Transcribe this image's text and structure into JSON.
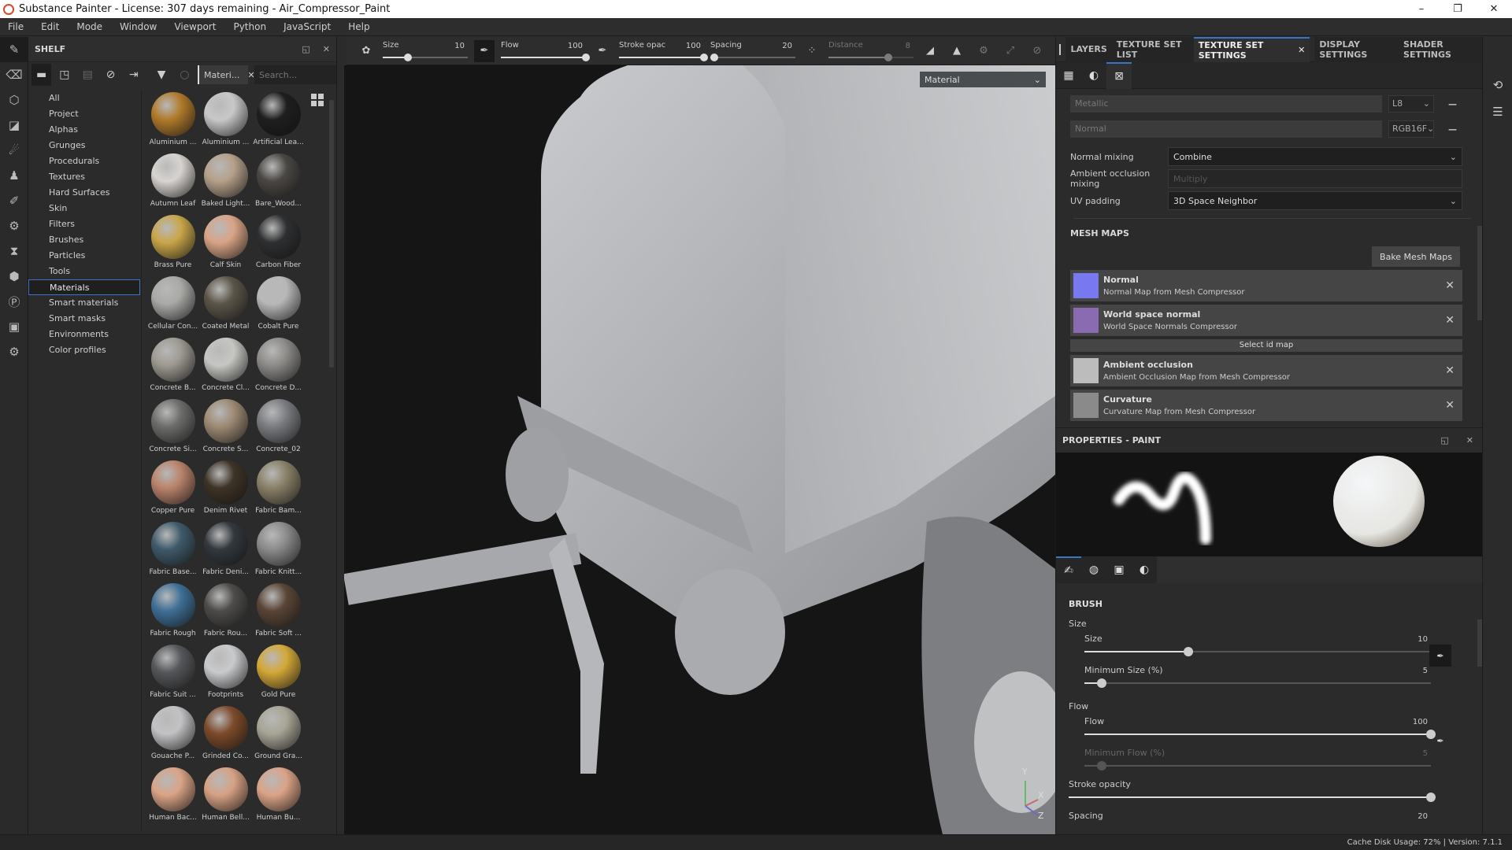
{
  "window": {
    "title": "Substance Painter - License: 307 days remaining - Air_Compressor_Paint",
    "minimize": "–",
    "restore": "❐",
    "close": "✕"
  },
  "menu": [
    "File",
    "Edit",
    "Mode",
    "Window",
    "Viewport",
    "Python",
    "JavaScript",
    "Help"
  ],
  "shelf": {
    "title": "SHELF",
    "filter_tab": "Materi...",
    "search_placeholder": "Search...",
    "categories": [
      "All",
      "Project",
      "Alphas",
      "Grunges",
      "Procedurals",
      "Textures",
      "Hard Surfaces",
      "Skin",
      "Filters",
      "Brushes",
      "Particles",
      "Tools",
      "Materials",
      "Smart materials",
      "Smart masks",
      "Environments",
      "Color profiles"
    ],
    "selected_category": "Materials",
    "materials": [
      {
        "name": "Aluminium ...",
        "color": "#b07a2a"
      },
      {
        "name": "Aluminium ...",
        "color": "#c8c8c8"
      },
      {
        "name": "Artificial Lea...",
        "color": "#1e1e1e"
      },
      {
        "name": "Autumn Leaf",
        "color": "#d8d4d0"
      },
      {
        "name": "Baked Light...",
        "color": "#b5a08a"
      },
      {
        "name": "Bare_Wood...",
        "color": "#4a4743"
      },
      {
        "name": "Brass Pure",
        "color": "#c9a64a"
      },
      {
        "name": "Calf Skin",
        "color": "#d9a487"
      },
      {
        "name": "Carbon Fiber",
        "color": "#2e2f31"
      },
      {
        "name": "Cellular Con...",
        "color": "#a9a9a6"
      },
      {
        "name": "Coated Metal",
        "color": "#5b5548"
      },
      {
        "name": "Cobalt Pure",
        "color": "#b8b8b8"
      },
      {
        "name": "Concrete B...",
        "color": "#9e9a92"
      },
      {
        "name": "Concrete Cl...",
        "color": "#c6c6c2"
      },
      {
        "name": "Concrete D...",
        "color": "#8c8b88"
      },
      {
        "name": "Concrete Si...",
        "color": "#6c6c6a"
      },
      {
        "name": "Concrete S...",
        "color": "#9d8a74"
      },
      {
        "name": "Concrete_02",
        "color": "#7a7c80"
      },
      {
        "name": "Copper Pure",
        "color": "#b9826a"
      },
      {
        "name": "Denim Rivet",
        "color": "#3e3326"
      },
      {
        "name": "Fabric Bam...",
        "color": "#8a8068"
      },
      {
        "name": "Fabric Base...",
        "color": "#3f5a6b"
      },
      {
        "name": "Fabric Deni...",
        "color": "#32383e"
      },
      {
        "name": "Fabric Knitt...",
        "color": "#8b8b8b"
      },
      {
        "name": "Fabric Rough",
        "color": "#3f6f96"
      },
      {
        "name": "Fabric Rou...",
        "color": "#4d4c4a"
      },
      {
        "name": "Fabric Soft ...",
        "color": "#5a4536"
      },
      {
        "name": "Fabric Suit ...",
        "color": "#55575a"
      },
      {
        "name": "Footprints",
        "color": "#c9cacc"
      },
      {
        "name": "Gold Pure",
        "color": "#d4a838"
      },
      {
        "name": "Gouache P...",
        "color": "#c2c2c4"
      },
      {
        "name": "Grinded Co...",
        "color": "#7d4a2a"
      },
      {
        "name": "Ground Gra...",
        "color": "#a8a596"
      },
      {
        "name": "Human Bac...",
        "color": "#d9a386"
      },
      {
        "name": "Human Bell...",
        "color": "#d6a184"
      },
      {
        "name": "Human Bu...",
        "color": "#daa387"
      }
    ]
  },
  "toolbar": {
    "size": {
      "label": "Size",
      "value": "10",
      "fraction": 0.3
    },
    "flow": {
      "label": "Flow",
      "value": "100",
      "fraction": 1.0
    },
    "stroke_opacity": {
      "label": "Stroke opac",
      "value": "100",
      "fraction": 1.0
    },
    "spacing": {
      "label": "Spacing",
      "value": "20",
      "fraction": 0.05
    },
    "distance": {
      "label": "Distance",
      "value": "8",
      "fraction": 0.7
    }
  },
  "viewport": {
    "channel_select": "Material",
    "axes": {
      "y": "Y",
      "x": "X",
      "z": "Z"
    }
  },
  "right_tabs": [
    "LAYERS",
    "TEXTURE SET LIST",
    "TEXTURE SET SETTINGS",
    "DISPLAY SETTINGS",
    "SHADER SETTINGS"
  ],
  "active_right_tab": "TEXTURE SET SETTINGS",
  "texture_set": {
    "channels": [
      {
        "name": "Metallic",
        "format": "L8"
      },
      {
        "name": "Normal",
        "format": "RGB16F"
      }
    ],
    "normal_mixing_label": "Normal mixing",
    "normal_mixing": "Combine",
    "ao_mixing_label": "Ambient occlusion mixing",
    "ao_mixing": "Multiply",
    "uv_padding_label": "UV padding",
    "uv_padding": "3D Space Neighbor",
    "mesh_maps_title": "MESH MAPS",
    "bake_button": "Bake Mesh Maps",
    "mesh_maps": [
      {
        "title": "Normal",
        "subtitle": "Normal Map from Mesh Compressor",
        "color": "#7878f0"
      },
      {
        "title": "World space normal",
        "subtitle": "World Space Normals Compressor",
        "color": "#8a6ab0"
      },
      {
        "title": "Ambient occlusion",
        "subtitle": "Ambient Occlusion Map from Mesh Compressor",
        "color": "#bcbcbc"
      },
      {
        "title": "Curvature",
        "subtitle": "Curvature Map from Mesh Compressor",
        "color": "#8a8a8a"
      }
    ],
    "select_id_map": "Select id map"
  },
  "properties": {
    "title": "PROPERTIES - PAINT",
    "brush_title": "BRUSH",
    "size_group": "Size",
    "size": {
      "label": "Size",
      "value": "10",
      "fraction": 0.3
    },
    "min_size": {
      "label": "Minimum Size (%)",
      "value": "5",
      "fraction": 0.05
    },
    "flow_group": "Flow",
    "flow": {
      "label": "Flow",
      "value": "100",
      "fraction": 1.0
    },
    "min_flow": {
      "label": "Minimum Flow (%)",
      "value": "5",
      "fraction": 0.05
    },
    "stroke_opacity": {
      "label": "Stroke opacity",
      "fraction": 1.0
    },
    "spacing": {
      "label": "Spacing",
      "value": "20"
    }
  },
  "status": {
    "text": "Cache Disk Usage:   72% | Version: 7.1.1"
  }
}
